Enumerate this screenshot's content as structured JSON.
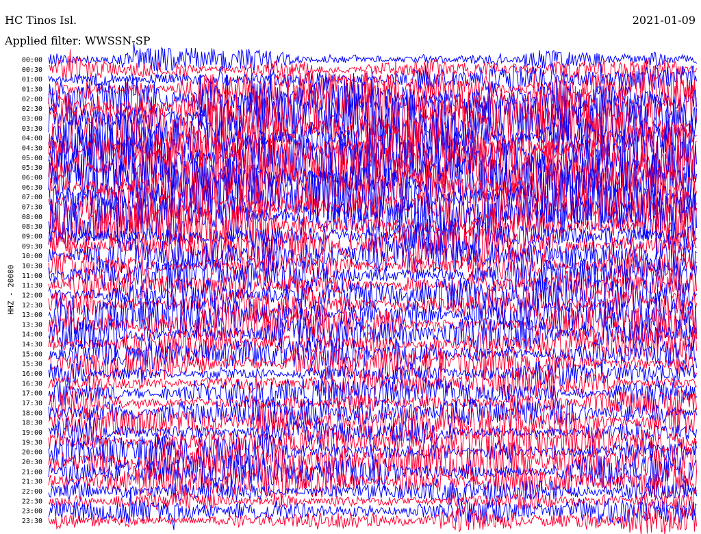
{
  "header": {
    "station": "HC Tinos Isl.",
    "date": "2021-01-09",
    "filter_label": "Applied filter: WWSSN-SP"
  },
  "chart_data": {
    "type": "line",
    "title": "HC Tinos Isl.",
    "subtitle": "Applied filter: WWSSN-SP",
    "date": "2021-01-09",
    "ylabel": "HHZ - 20000",
    "xlabel": "",
    "rows": [
      "00:00",
      "00:30",
      "01:00",
      "01:30",
      "02:00",
      "02:30",
      "03:00",
      "03:30",
      "04:00",
      "04:30",
      "05:00",
      "05:30",
      "06:00",
      "06:30",
      "07:00",
      "07:30",
      "08:00",
      "08:30",
      "09:00",
      "09:30",
      "10:00",
      "10:30",
      "11:00",
      "11:30",
      "12:00",
      "12:30",
      "13:00",
      "13:30",
      "14:00",
      "14:30",
      "15:00",
      "15:30",
      "16:00",
      "16:30",
      "17:00",
      "17:30",
      "18:00",
      "18:30",
      "19:00",
      "19:30",
      "20:00",
      "20:30",
      "21:00",
      "21:30",
      "22:00",
      "22:30",
      "23:00",
      "23:30"
    ],
    "series_colors": [
      "#0000ff",
      "#ff0033"
    ],
    "relative_amplitude": [
      0.3,
      0.35,
      0.4,
      0.55,
      0.85,
      0.95,
      1.0,
      1.0,
      1.0,
      1.0,
      1.0,
      1.0,
      1.0,
      0.95,
      0.9,
      0.85,
      0.85,
      0.8,
      0.75,
      0.7,
      0.6,
      0.5,
      0.45,
      0.45,
      0.5,
      0.55,
      0.6,
      0.55,
      0.55,
      0.5,
      0.45,
      0.45,
      0.4,
      0.4,
      0.4,
      0.4,
      0.4,
      0.45,
      0.45,
      0.5,
      0.55,
      0.6,
      0.55,
      0.5,
      0.4,
      0.35,
      0.35,
      0.4
    ],
    "grid": false,
    "legend": "none"
  }
}
